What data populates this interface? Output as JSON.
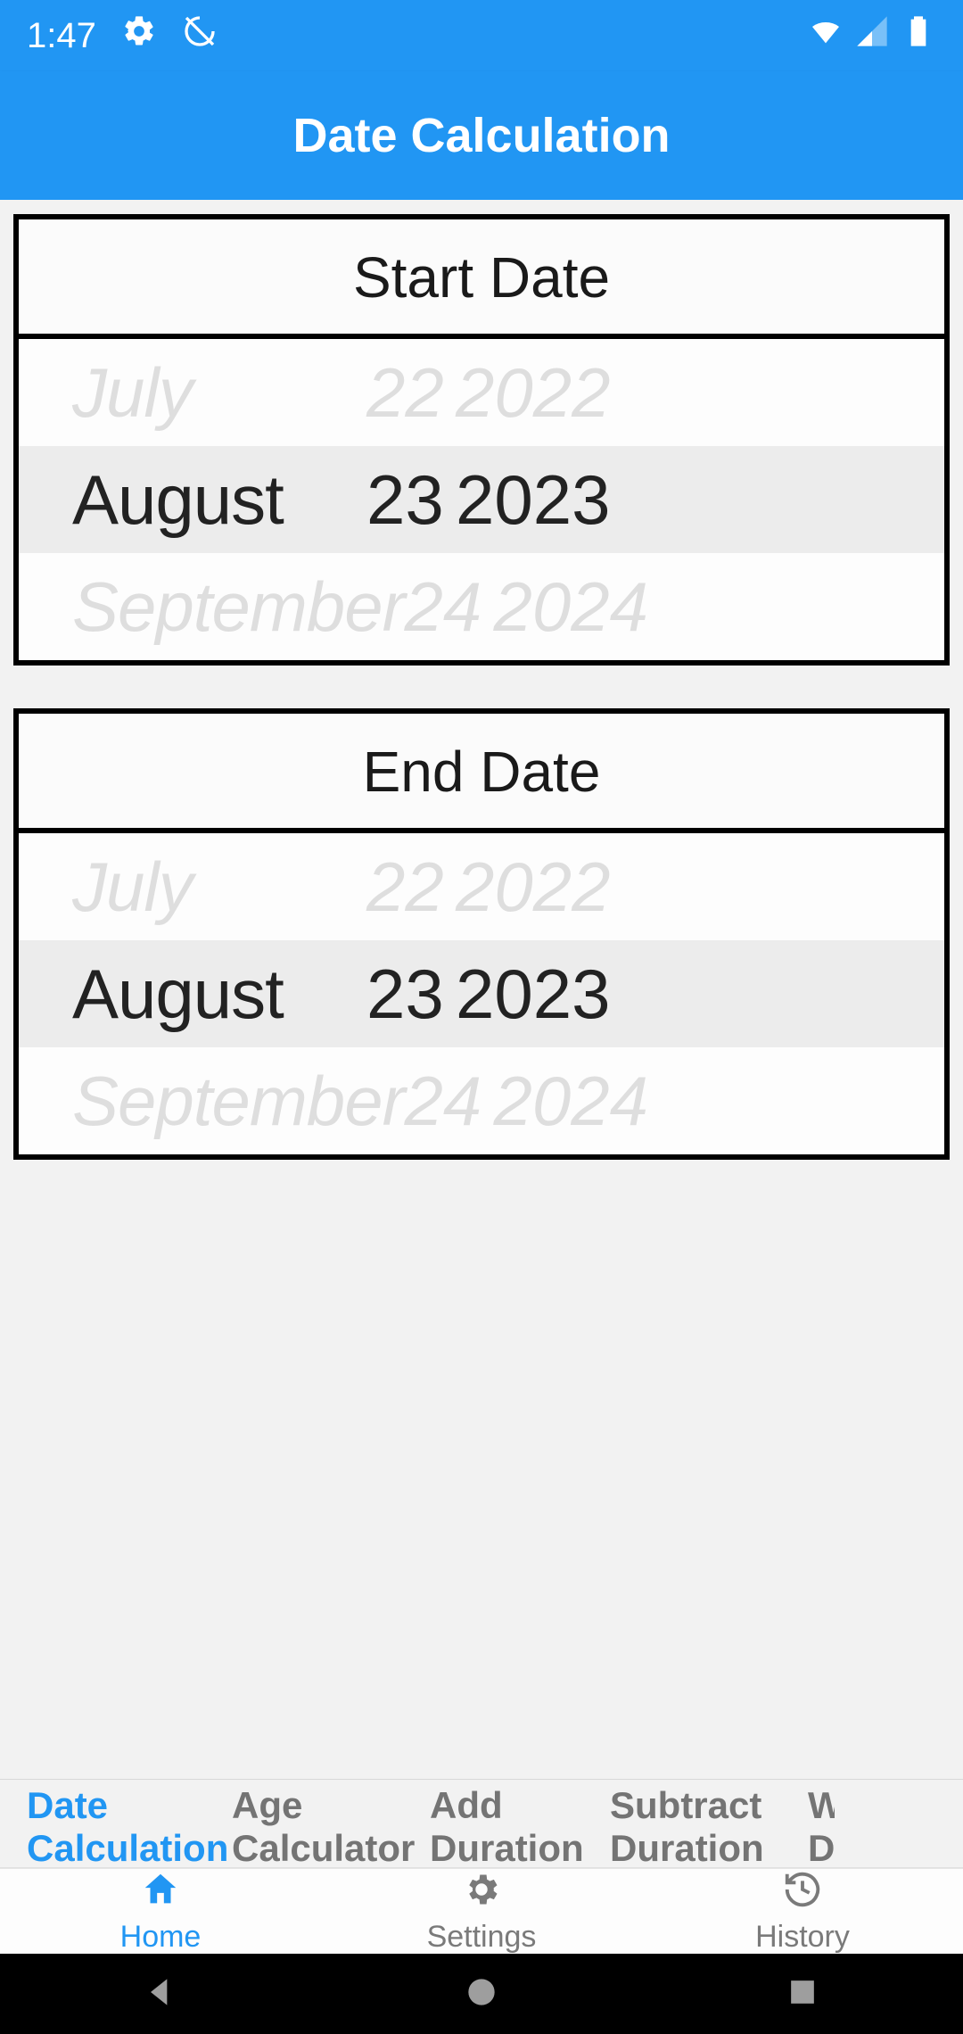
{
  "statusbar": {
    "time": "1:47"
  },
  "appbar": {
    "title": "Date Calculation"
  },
  "startDate": {
    "title": "Start Date",
    "prev": {
      "month": "July",
      "day": "22",
      "year": "2022"
    },
    "sel": {
      "month": "August",
      "day": "23",
      "year": "2023"
    },
    "next": {
      "month": "September",
      "day": "24",
      "year": "2024"
    }
  },
  "endDate": {
    "title": "End Date",
    "prev": {
      "month": "July",
      "day": "22",
      "year": "2022"
    },
    "sel": {
      "month": "August",
      "day": "23",
      "year": "2023"
    },
    "next": {
      "month": "September",
      "day": "24",
      "year": "2024"
    }
  },
  "subtabs": {
    "items": [
      "Date Calculation",
      "Age Calculator",
      "Add Duration",
      "Subtract Duration",
      "W"
    ],
    "truncated_last_line2": "D"
  },
  "bottomnav": {
    "home": "Home",
    "settings": "Settings",
    "history": "History"
  }
}
